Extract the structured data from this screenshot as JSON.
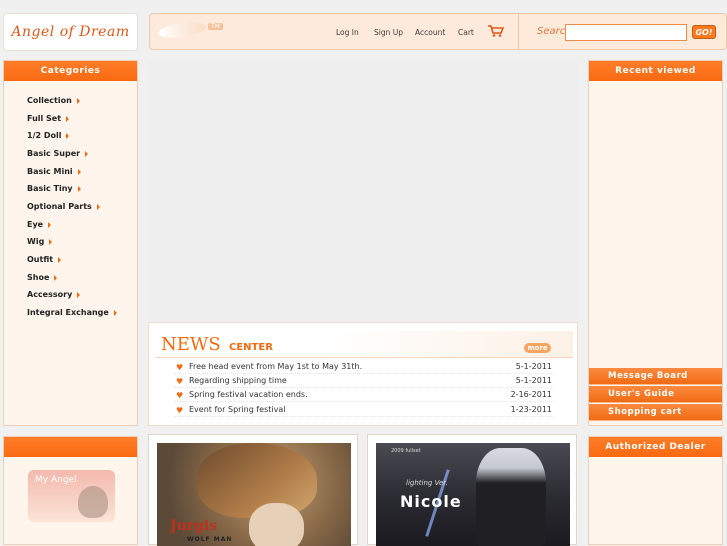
{
  "logo": {
    "text": "Angel of Dream"
  },
  "topbar": {
    "tm": "TM",
    "nav": [
      "Log In",
      "Sign Up",
      "Account",
      "Cart"
    ],
    "search_label": "Search",
    "search_value": "",
    "go_label": "GO!"
  },
  "categories": {
    "title": "Categories",
    "items": [
      "Collection",
      "Full Set",
      "1/2 Doll",
      "Basic Super",
      "Basic Mini",
      "Basic Tiny",
      "Optional Parts",
      "Eye",
      "Wig",
      "Outfit",
      "Shoe",
      "Accessory",
      "Integral Exchange"
    ]
  },
  "my_angel": {
    "label": "My Angel"
  },
  "news": {
    "title": "NEWS",
    "subtitle": "CENTER",
    "more": "more",
    "items": [
      {
        "text": "Free head event from May 1st to May 31th.",
        "date": "5-1-2011"
      },
      {
        "text": "Regarding shipping time",
        "date": "5-1-2011"
      },
      {
        "text": "Spring festival vacation ends.",
        "date": "2-16-2011"
      },
      {
        "text": "Event for Spring festival",
        "date": "1-23-2011"
      }
    ]
  },
  "right": {
    "recent_title": "Recent viewed",
    "links": [
      "Message Board",
      "User's Guide",
      "Shopping cart"
    ],
    "dealer_title": "Authorized Dealer"
  },
  "products": [
    {
      "name": "Jurgis",
      "sub": "WOLF MAN"
    },
    {
      "tag": "2009 fullset",
      "caption": "lighting Ver.",
      "name": "Nicole"
    }
  ],
  "colors": {
    "accent": "#f26a10",
    "panel_bg": "#fff5ec"
  }
}
